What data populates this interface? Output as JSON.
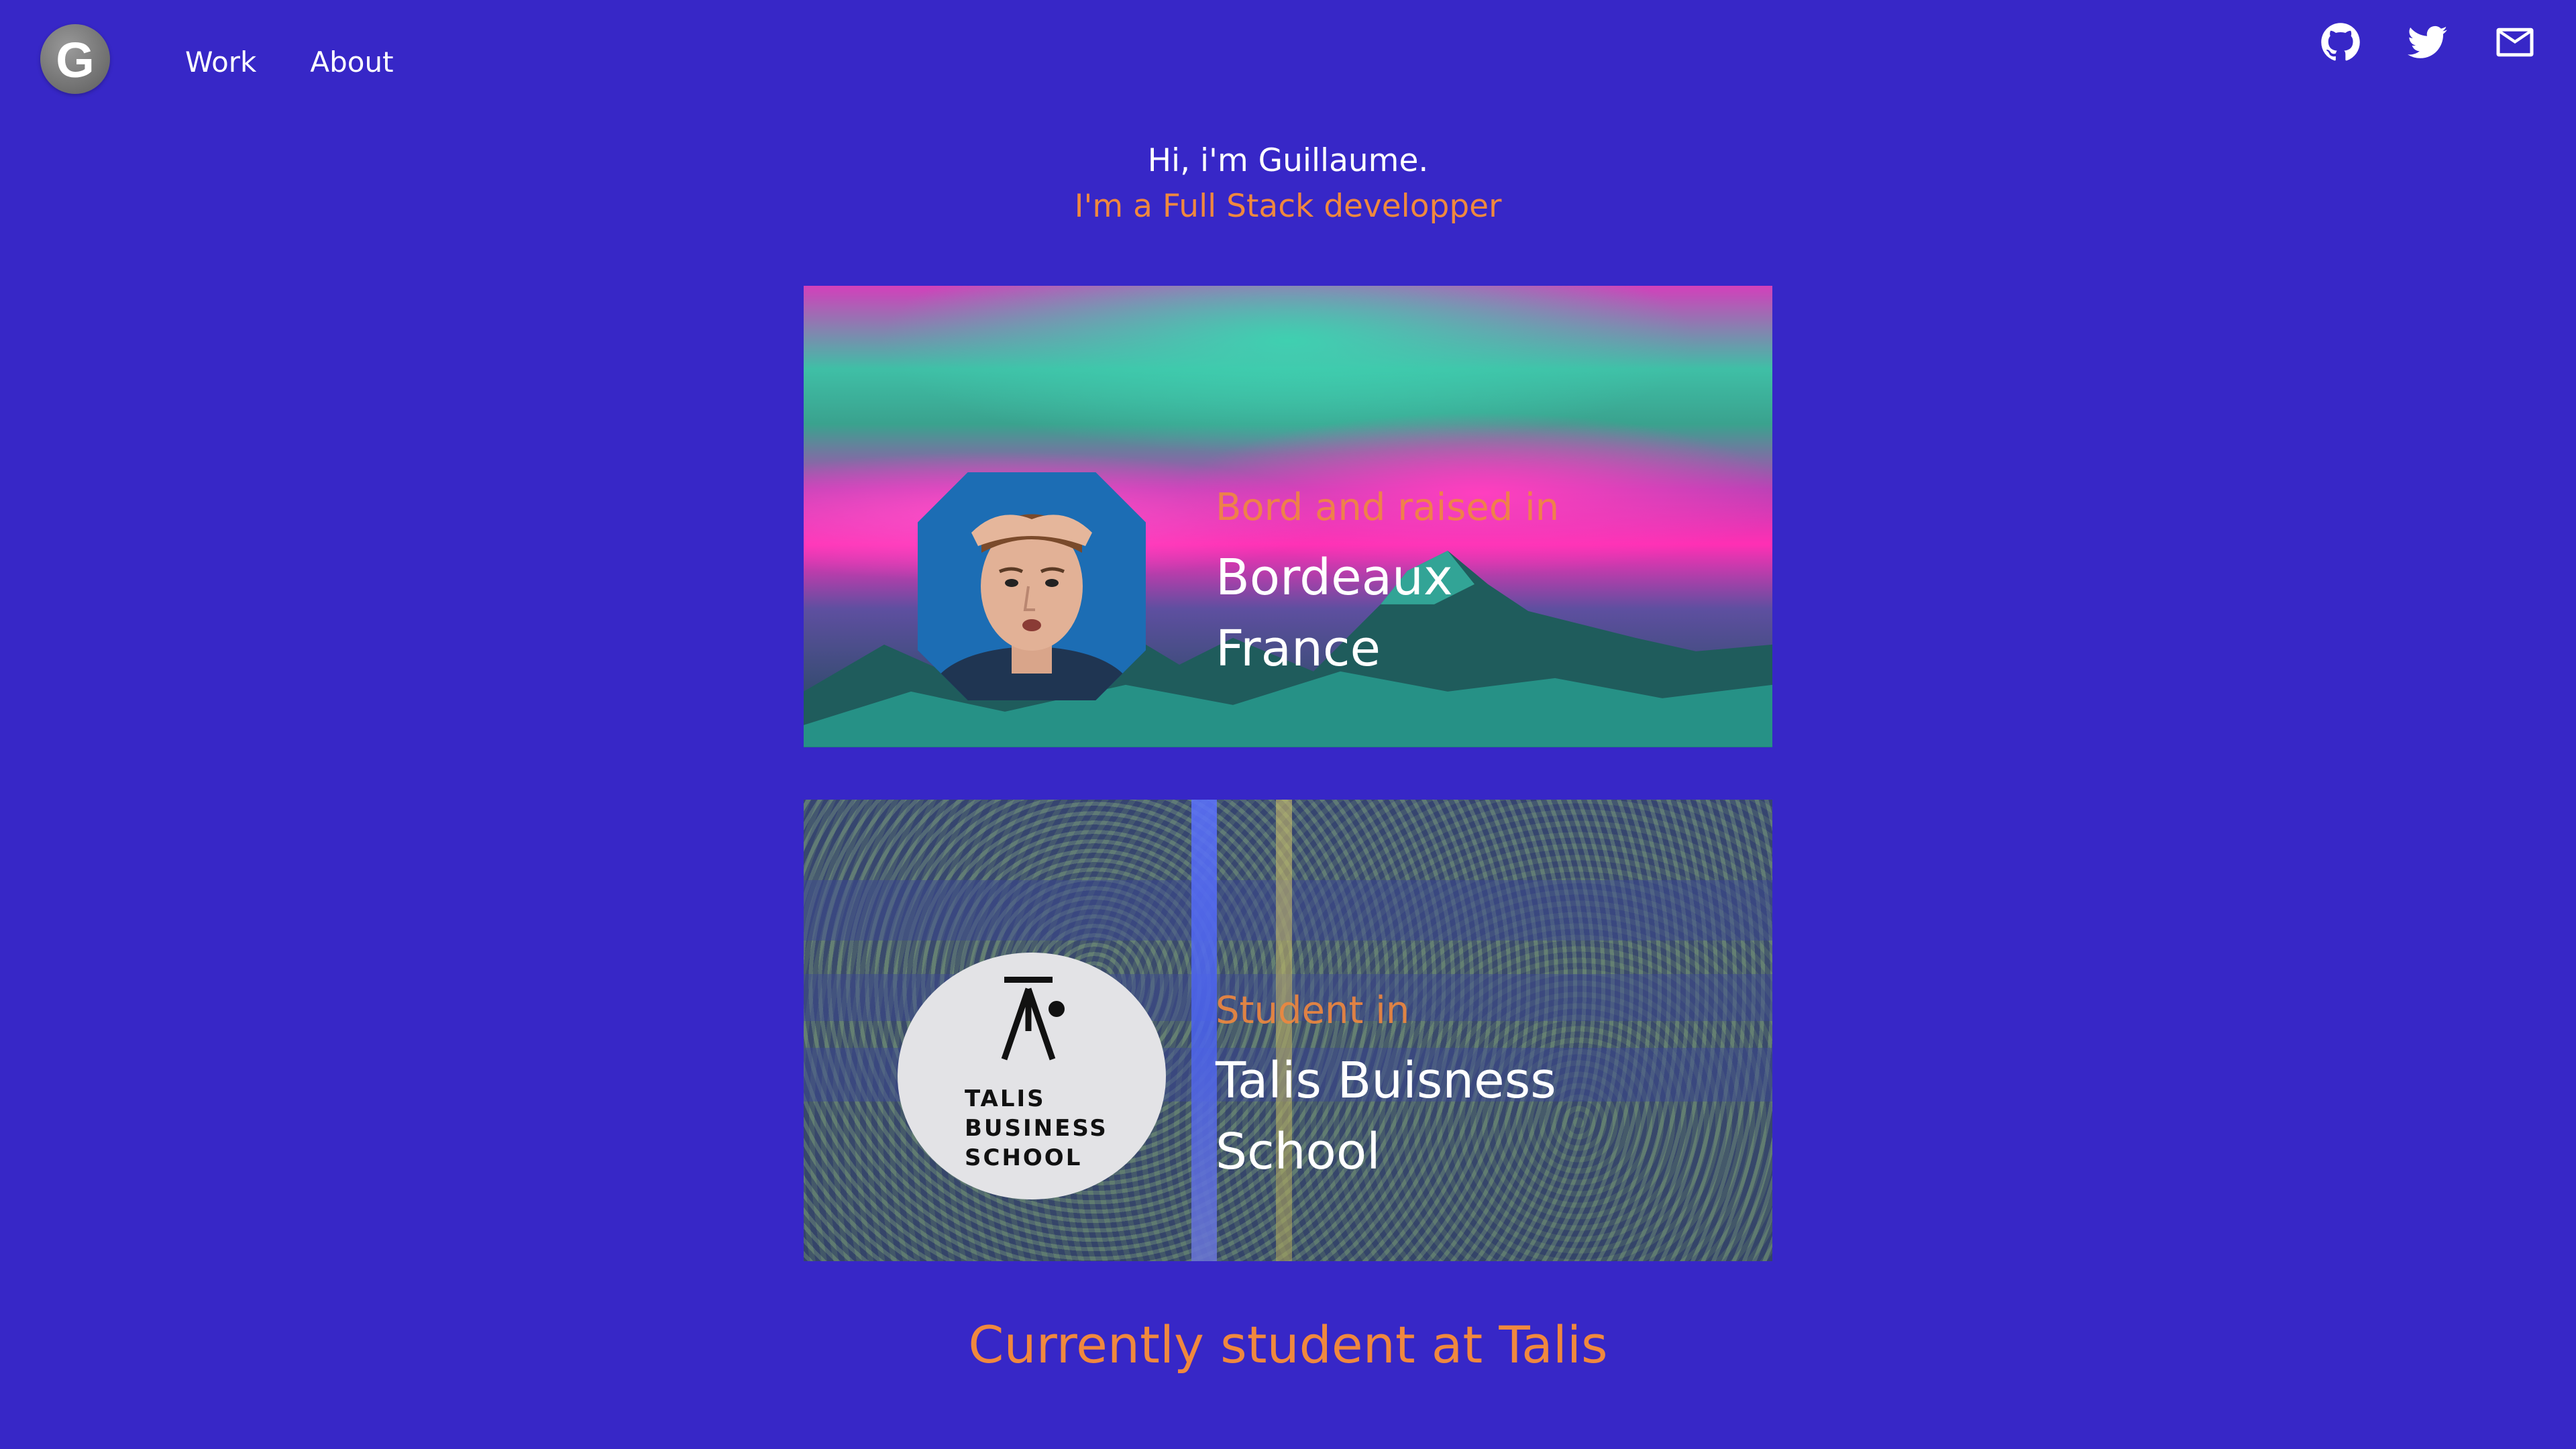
{
  "nav": {
    "logo_letter": "G",
    "links": [
      {
        "label": "Work"
      },
      {
        "label": "About"
      }
    ],
    "social": [
      {
        "icon": "github-icon"
      },
      {
        "icon": "twitter-icon"
      },
      {
        "icon": "mail-icon"
      }
    ]
  },
  "intro": {
    "greeting": "Hi, i'm Guillaume.",
    "role": "I'm a Full Stack developper"
  },
  "cards": [
    {
      "kicker": "Bord and raised in",
      "title": "Bordeaux\nFrance",
      "image": "portrait-photo"
    },
    {
      "kicker": "Student in",
      "title": "Talis Buisness\nSchool",
      "image": "talis-business-school-logo",
      "logo_text": "TALIS\nBUSINESS\nSCHOOL"
    }
  ],
  "footer": {
    "text": "Currently student at Talis"
  },
  "colors": {
    "background": "#3727c7",
    "accent": "#f0883e",
    "text": "#ffffff"
  }
}
